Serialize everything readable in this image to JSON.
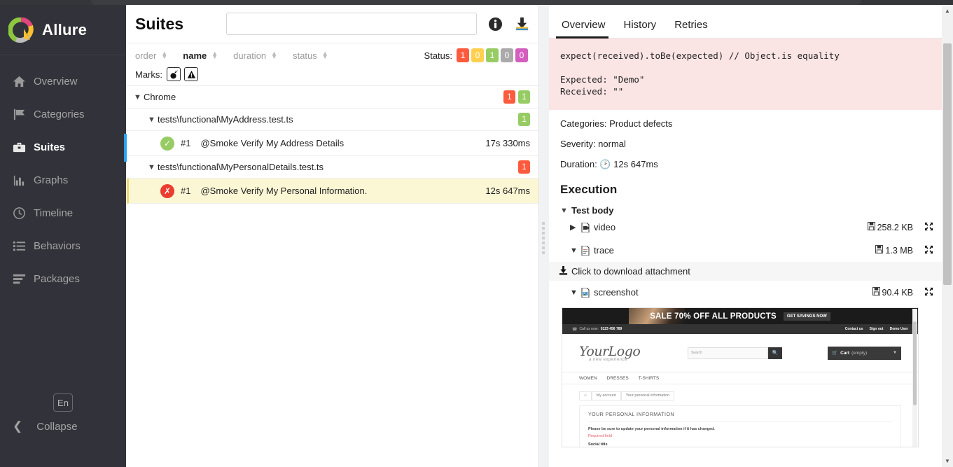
{
  "brand": {
    "name": "Allure",
    "logo_icon": "allure-logo-icon"
  },
  "sidebar": {
    "items": [
      {
        "label": "Overview",
        "icon": "home-icon",
        "active": false
      },
      {
        "label": "Categories",
        "icon": "flag-icon",
        "active": false
      },
      {
        "label": "Suites",
        "icon": "briefcase-icon",
        "active": true
      },
      {
        "label": "Graphs",
        "icon": "bar-chart-icon",
        "active": false
      },
      {
        "label": "Timeline",
        "icon": "clock-icon",
        "active": false
      },
      {
        "label": "Behaviors",
        "icon": "list-icon",
        "active": false
      },
      {
        "label": "Packages",
        "icon": "layers-icon",
        "active": false
      }
    ],
    "language": "En",
    "collapse_label": "Collapse",
    "collapse_icon": "chevron-left-icon"
  },
  "center": {
    "title": "Suites",
    "search_value": "",
    "search_placeholder": "",
    "info_icon": "info-icon",
    "download_icon": "download-icon",
    "sort": [
      {
        "label": "order",
        "active": false
      },
      {
        "label": "name",
        "active": true
      },
      {
        "label": "duration",
        "active": false
      },
      {
        "label": "status",
        "active": false
      }
    ],
    "status_label": "Status:",
    "status_chips": [
      {
        "value": "1",
        "color": "#fd5a3e",
        "name": "failed"
      },
      {
        "value": "0",
        "color": "#ffd050",
        "name": "broken"
      },
      {
        "value": "1",
        "color": "#97cc64",
        "name": "passed"
      },
      {
        "value": "0",
        "color": "#aaaaaa",
        "name": "skipped"
      },
      {
        "value": "0",
        "color": "#d35ebe",
        "name": "unknown"
      }
    ],
    "marks_label": "Marks:",
    "marks": [
      {
        "icon": "bomb-icon",
        "glyph": "💣"
      },
      {
        "icon": "warning-triangle-icon",
        "glyph": "⚠"
      }
    ],
    "tree": [
      {
        "level": 0,
        "label": "Chrome",
        "expanded": true,
        "type": "suite",
        "badges": [
          {
            "value": "1",
            "color": "#fd5a3e"
          },
          {
            "value": "1",
            "color": "#97cc64"
          }
        ]
      },
      {
        "level": 1,
        "label": "tests\\functional\\MyAddress.test.ts",
        "expanded": true,
        "type": "suite",
        "badges": [
          {
            "value": "1",
            "color": "#97cc64"
          }
        ]
      },
      {
        "level": 2,
        "type": "test",
        "status": "passed",
        "status_icon": "check-circle-icon",
        "number": "#1",
        "label": "@Smoke Verify My Address Details",
        "duration": "17s 330ms",
        "selected": false
      },
      {
        "level": 1,
        "label": "tests\\functional\\MyPersonalDetails.test.ts",
        "expanded": true,
        "type": "suite",
        "badges": [
          {
            "value": "1",
            "color": "#fd5a3e"
          }
        ]
      },
      {
        "level": 2,
        "type": "test",
        "status": "failed",
        "status_icon": "x-circle-icon",
        "number": "#1",
        "label": "@Smoke Verify My Personal Information.",
        "duration": "12s 647ms",
        "selected": true
      }
    ]
  },
  "detail": {
    "tabs": [
      {
        "label": "Overview",
        "active": true
      },
      {
        "label": "History",
        "active": false
      },
      {
        "label": "Retries",
        "active": false
      }
    ],
    "error_message": "expect(received).toBe(expected) // Object.is equality\n\nExpected: \"Demo\"\nReceived: \"\"",
    "categories": "Categories: Product defects",
    "severity": "Severity: normal",
    "duration": "Duration:",
    "duration_value": "12s 647ms",
    "duration_icon": "clock-icon",
    "execution_heading": "Execution",
    "test_body_label": "Test body",
    "attachments": [
      {
        "label": "video",
        "icon": "video-file-icon",
        "size": "258.2 KB",
        "expanded": false,
        "caret": "collapsed",
        "expand_icon": "fullscreen-icon",
        "size_icon": "floppy-disk-icon"
      },
      {
        "label": "trace",
        "icon": "text-file-icon",
        "size": "1.3 MB",
        "expanded": true,
        "caret": "expanded",
        "expand_icon": "fullscreen-icon",
        "size_icon": "floppy-disk-icon"
      },
      {
        "label": "screenshot",
        "icon": "image-file-icon",
        "size": "90.4 KB",
        "expanded": true,
        "caret": "expanded",
        "expand_icon": "fullscreen-icon",
        "size_icon": "floppy-disk-icon"
      }
    ],
    "download_attachment_label": "Click to download attachment",
    "download_attachment_icon": "download-icon"
  },
  "screenshot_preview": {
    "banner_text": "SALE 70% OFF ALL PRODUCTS",
    "banner_cta": "GET SAVINGS NOW",
    "callus": "Call us now:",
    "phone": "0123 456 789",
    "top_links": [
      "Contact us",
      "Sign out",
      "Demo User"
    ],
    "logo_main": "YourLogo",
    "logo_sub": "a new experience",
    "search_placeholder": "Search",
    "search_icon": "magnifier-icon",
    "cart_label": "Cart",
    "cart_state": "(empty)",
    "cart_icon": "cart-icon",
    "menu": [
      "WOMEN",
      "DRESSES",
      "T-SHIRTS"
    ],
    "breadcrumb": [
      "My account",
      "Your personal information"
    ],
    "breadcrumb_home_icon": "home-icon",
    "card_heading": "YOUR PERSONAL INFORMATION",
    "card_text": "Please be sure to update your personal information if it has changed.",
    "card_required": "Required field",
    "card_social": "Social title"
  },
  "scrollbar": {
    "up_icon": "triangle-up-icon",
    "down_icon": "triangle-down-icon"
  }
}
